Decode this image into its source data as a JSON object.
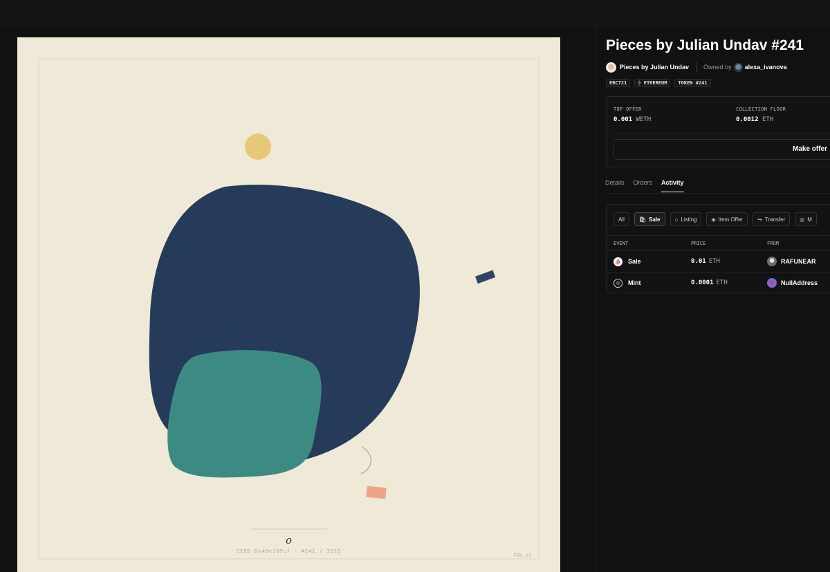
{
  "artwork": {
    "title_glyph": "o",
    "seed_line": "SEED 0x49e199cf · #241 / 3333",
    "version": "P3U.v1",
    "colors": {
      "background": "#efe9d7",
      "navy": "#263a5a",
      "teal": "#3c8b82",
      "gold": "#e7c876",
      "salmon": "#eba584"
    }
  },
  "header": {
    "title": "Pieces by Julian Undav #241",
    "collection_name": "Pieces by Julian Undav",
    "owned_by_label": "Owned by",
    "owner_name": "alexa_ivanova"
  },
  "tags": [
    "ERC721",
    "⟠ ETHEREUM",
    "TOKEN #241"
  ],
  "offers": {
    "top_offer_label": "TOP OFFER",
    "top_offer_value": "0.001",
    "top_offer_unit": "WETH",
    "floor_label": "COLLECTION FLOOR",
    "floor_value": "0.0012",
    "floor_unit": "ETH",
    "make_offer_label": "Make offer"
  },
  "tabs": [
    {
      "label": "Details",
      "active": false
    },
    {
      "label": "Orders",
      "active": false
    },
    {
      "label": "Activity",
      "active": true
    }
  ],
  "activity": {
    "filters": [
      {
        "label": "All",
        "icon": "",
        "active": false
      },
      {
        "label": "Sale",
        "icon": "🛍",
        "active": true
      },
      {
        "label": "Listing",
        "icon": "⌂",
        "active": false
      },
      {
        "label": "Item Offer",
        "icon": "◈",
        "active": false
      },
      {
        "label": "Transfer",
        "icon": "↪",
        "active": false
      },
      {
        "label": "M",
        "icon": "◎",
        "active": false
      }
    ],
    "columns": [
      "EVENT",
      "PRICE",
      "FROM"
    ],
    "rows": [
      {
        "event": "Sale",
        "price": "0.01",
        "unit": "ETH",
        "from": "RAFUNEAR"
      },
      {
        "event": "Mint",
        "price": "0.0001",
        "unit": "ETH",
        "from": "NullAddress"
      }
    ]
  }
}
